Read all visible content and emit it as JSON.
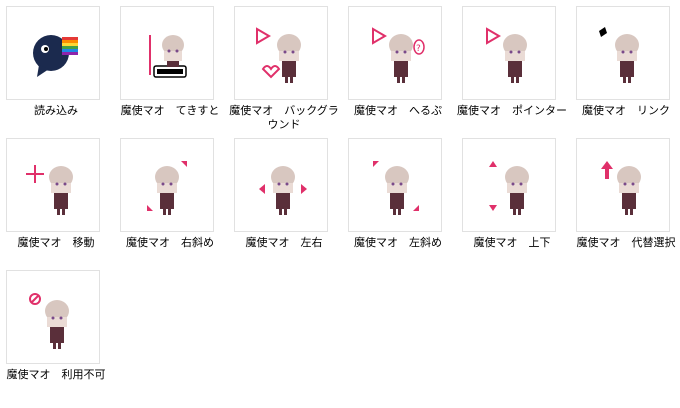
{
  "files": [
    {
      "name": "読み込み",
      "icon": "bird-rainbow-icon"
    },
    {
      "name": "魔使マオ　てきすと",
      "icon": "text-cursor-icon"
    },
    {
      "name": "魔使マオ　バックグラウンド",
      "icon": "background-busy-cursor-icon"
    },
    {
      "name": "魔使マオ　へるぷ",
      "icon": "help-cursor-icon"
    },
    {
      "name": "魔使マオ　ポインター",
      "icon": "pointer-cursor-icon"
    },
    {
      "name": "魔使マオ　リンク",
      "icon": "link-cursor-icon"
    },
    {
      "name": "魔使マオ　移動",
      "icon": "move-cursor-icon"
    },
    {
      "name": "魔使マオ　右斜め",
      "icon": "resize-diagonal-right-icon"
    },
    {
      "name": "魔使マオ　左右",
      "icon": "resize-horizontal-icon"
    },
    {
      "name": "魔使マオ　左斜め",
      "icon": "resize-diagonal-left-icon"
    },
    {
      "name": "魔使マオ　上下",
      "icon": "resize-vertical-icon"
    },
    {
      "name": "魔使マオ　代替選択",
      "icon": "alternate-select-icon"
    },
    {
      "name": "魔使マオ　利用不可",
      "icon": "unavailable-cursor-icon"
    }
  ],
  "colors": {
    "accent_pink": "#e0306a",
    "hair": "#d8c7c0",
    "outfit": "#5a2f3a",
    "thumb_border": "#e1e1e1"
  }
}
